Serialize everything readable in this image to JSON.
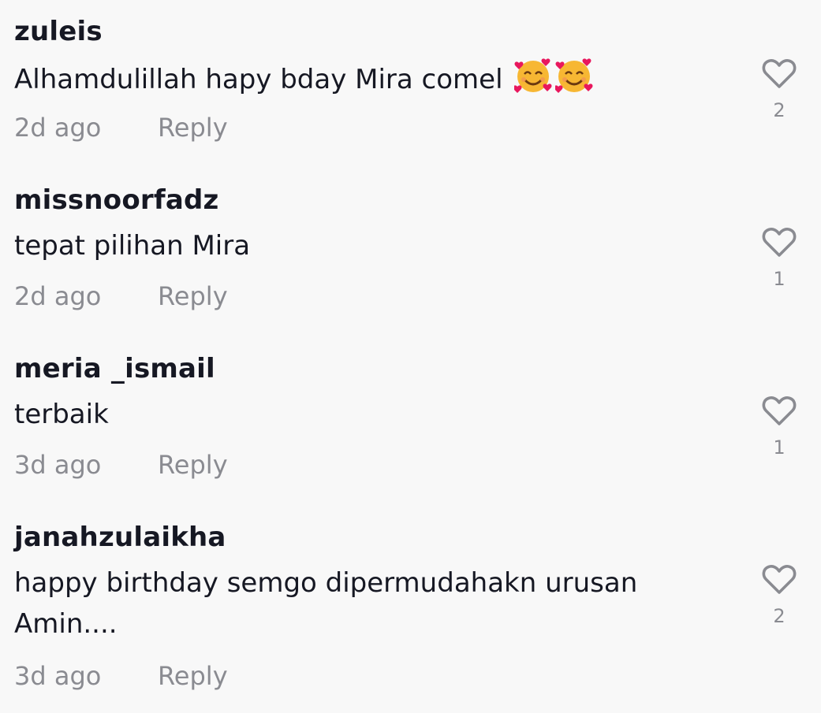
{
  "comments": [
    {
      "username": "zuleis",
      "text": "Alhamdulillah hapy bday Mira comel",
      "emojis": [
        "smiling-face-with-hearts-icon",
        "smiling-face-with-hearts-icon"
      ],
      "time": "2d ago",
      "reply_label": "Reply",
      "likes": "2"
    },
    {
      "username": "missnoorfadz",
      "text": "tepat pilihan Mira",
      "time": "2d ago",
      "reply_label": "Reply",
      "likes": "1"
    },
    {
      "username": "meria _ismail",
      "text": "terbaik",
      "time": "3d ago",
      "reply_label": "Reply",
      "likes": "1"
    },
    {
      "username": "janahzulaikha",
      "text": "happy birthday semgo dipermudahakn urusan\nAmin....",
      "time": "3d ago",
      "reply_label": "Reply",
      "likes": "2"
    }
  ],
  "colors": {
    "background": "#f8f8f8",
    "primary_text": "#161823",
    "secondary_text": "#8a8b91",
    "heart_outline": "#8a8b91"
  }
}
